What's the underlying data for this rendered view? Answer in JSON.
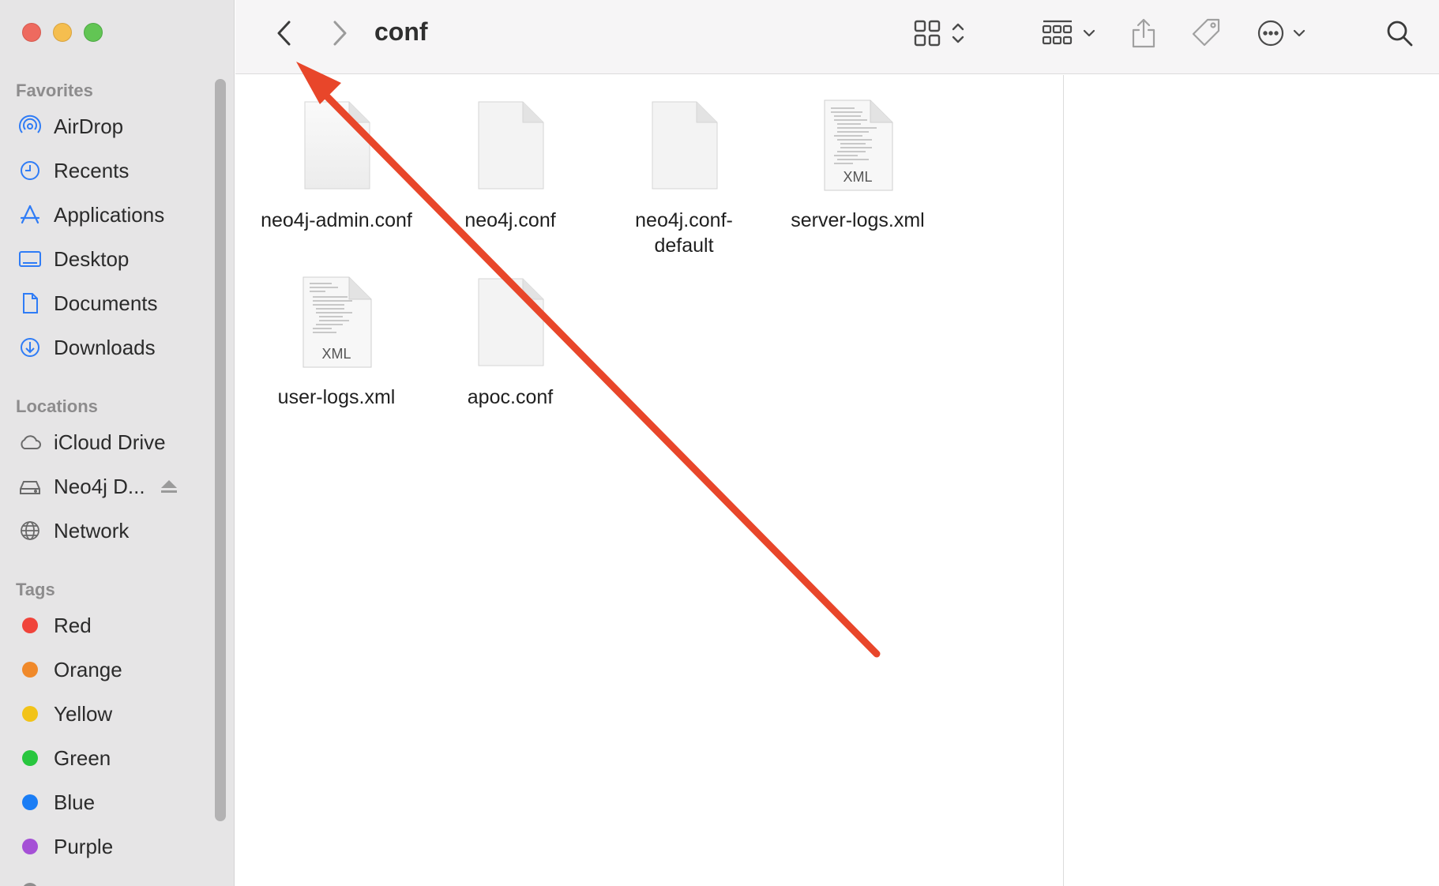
{
  "toolbar": {
    "title": "conf"
  },
  "sidebar": {
    "favorites_title": "Favorites",
    "favorites": [
      {
        "label": "AirDrop",
        "icon": "airdrop-icon"
      },
      {
        "label": "Recents",
        "icon": "clock-icon"
      },
      {
        "label": "Applications",
        "icon": "applications-icon"
      },
      {
        "label": "Desktop",
        "icon": "desktop-icon"
      },
      {
        "label": "Documents",
        "icon": "document-icon"
      },
      {
        "label": "Downloads",
        "icon": "download-icon"
      }
    ],
    "locations_title": "Locations",
    "locations": [
      {
        "label": "iCloud Drive",
        "icon": "cloud-icon"
      },
      {
        "label": "Neo4j D...",
        "icon": "drive-icon"
      },
      {
        "label": "Network",
        "icon": "globe-icon"
      }
    ],
    "tags_title": "Tags",
    "tags": [
      {
        "label": "Red",
        "color": "#f0443b"
      },
      {
        "label": "Orange",
        "color": "#f0892a"
      },
      {
        "label": "Yellow",
        "color": "#f2c318"
      },
      {
        "label": "Green",
        "color": "#28c63e"
      },
      {
        "label": "Blue",
        "color": "#1a7df5"
      },
      {
        "label": "Purple",
        "color": "#a550d6"
      }
    ]
  },
  "files": [
    {
      "name": "neo4j-admin.conf",
      "type": "blank"
    },
    {
      "name": "neo4j.conf",
      "type": "blank"
    },
    {
      "name": "neo4j.conf-\ndefault",
      "type": "blank"
    },
    {
      "name": "server-logs.xml",
      "type": "xml",
      "badge": "XML"
    },
    {
      "name": "user-logs.xml",
      "type": "xml",
      "badge": "XML"
    },
    {
      "name": "apoc.conf",
      "type": "blank"
    }
  ],
  "annotation": {
    "color": "#e8462a"
  }
}
